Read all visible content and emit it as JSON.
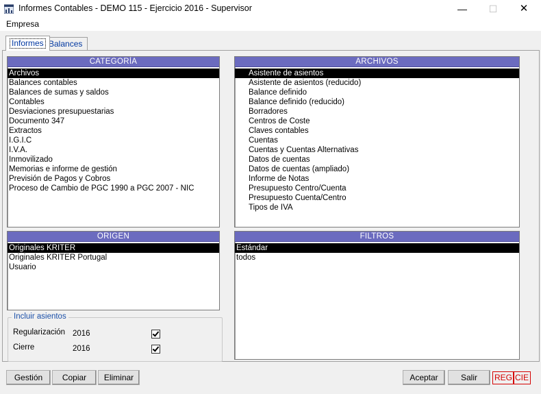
{
  "window": {
    "title": "Informes Contables - DEMO 115 - Ejercicio 2016 - Supervisor",
    "min_glyph": "—",
    "max_glyph": "☐",
    "close_glyph": "✕"
  },
  "menu": {
    "items": [
      "Empresa"
    ]
  },
  "tabs": [
    {
      "label": "Informes",
      "active": true
    },
    {
      "label": "Balances",
      "active": false
    }
  ],
  "categoria": {
    "header": "CATEGORÍA",
    "items": [
      "Archivos",
      "Balances contables",
      "Balances de sumas y saldos",
      "Contables",
      "Desviaciones presupuestarias",
      "Documento 347",
      "Extractos",
      "I.G.I.C",
      "I.V.A.",
      "Inmovilizado",
      "Memorias e informe de gestión",
      "Previsión de Pagos y Cobros",
      "Proceso de Cambio de PGC 1990 a PGC 2007 - NIC"
    ],
    "selected": 0
  },
  "archivos": {
    "header": "ARCHIVOS",
    "items": [
      "Asistente de asientos",
      "Asistente de asientos (reducido)",
      "Balance definido",
      "Balance definido (reducido)",
      "Borradores",
      "Centros de Coste",
      "Claves contables",
      "Cuentas",
      "Cuentas y Cuentas Alternativas",
      "Datos de cuentas",
      "Datos de cuentas (ampliado)",
      "Informe de Notas",
      "Presupuesto Centro/Cuenta",
      "Presupuesto Cuenta/Centro",
      "Tipos de IVA"
    ],
    "selected": 0
  },
  "origen": {
    "header": "ORIGEN",
    "items": [
      "Originales KRITER",
      "Originales KRITER Portugal",
      "Usuario"
    ],
    "selected": 0
  },
  "filtros": {
    "header": "FILTROS",
    "items": [
      "Estándar",
      "todos"
    ],
    "selected": 0
  },
  "incluir_asientos": {
    "legend": "Incluir asientos",
    "rows": [
      {
        "label": "Regularización",
        "year": "2016",
        "checked": true
      },
      {
        "label": "Cierre",
        "year": "2016",
        "checked": true
      }
    ]
  },
  "buttons": {
    "gestion": "Gestión",
    "copiar": "Copiar",
    "eliminar": "Eliminar",
    "aceptar": "Aceptar",
    "salir": "Salir"
  },
  "badges": {
    "reg": "REG",
    "cie": "CIE"
  }
}
